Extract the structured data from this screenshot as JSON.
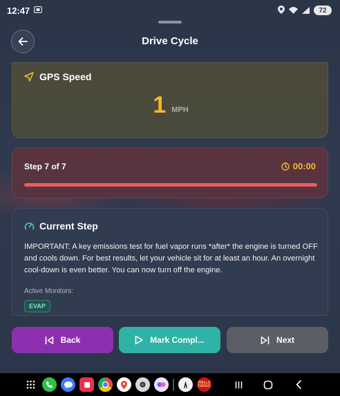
{
  "status_bar": {
    "time": "12:47",
    "battery": "72"
  },
  "header": {
    "title": "Drive Cycle"
  },
  "gps": {
    "label": "GPS Speed",
    "value": "1",
    "unit": "MPH"
  },
  "step": {
    "label": "Step 7 of 7",
    "timer": "00:00",
    "progress_fraction": 1.0
  },
  "current_step": {
    "title": "Current Step",
    "text": "IMPORTANT: A key emissions test for fuel vapor runs *after* the engine is turned OFF and cools down. For best results, let your vehicle sit for at least an hour. An overnight cool-down is even better. You can now turn off the engine.",
    "monitors_label": "Active Monitors:",
    "monitors": [
      "EVAP"
    ]
  },
  "actions": {
    "back_label": "Back",
    "mark_label": "Mark Compl...",
    "next_label": "Next"
  },
  "nav_bar": {
    "wells_fargo_label": "WELLS FARGO"
  },
  "colors": {
    "accent_yellow": "#f5b82e",
    "progress_red": "#ef5b60",
    "back_purple": "#8e2fb0",
    "mark_teal": "#2fb3a6",
    "next_gray": "#5b5e64"
  }
}
